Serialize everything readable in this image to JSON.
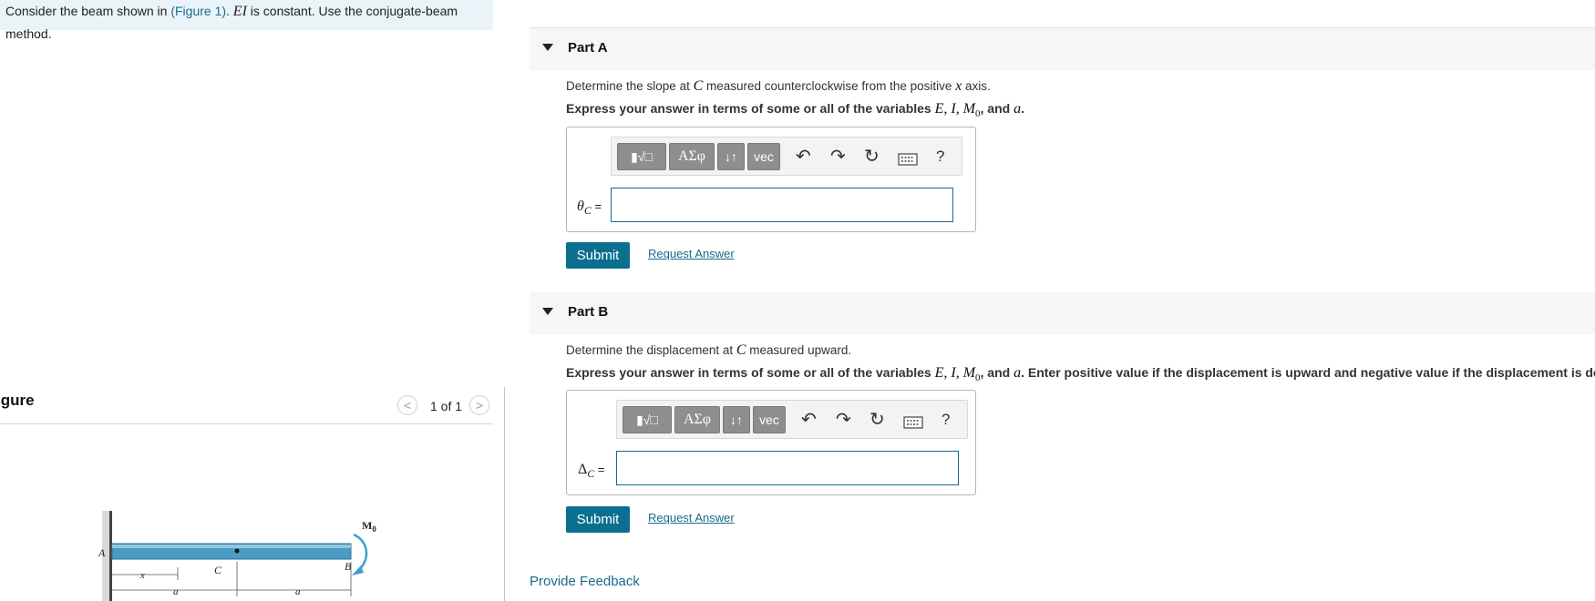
{
  "intro": {
    "text_before": "Consider the beam shown in ",
    "figure_link": "(Figure 1)",
    "text_middle": ". ",
    "ei": "EI",
    "text_after": " is constant. Use the conjugate-beam method."
  },
  "figure_panel": {
    "title": "igure",
    "pager": "1 of 1",
    "prev_icon": "chevron-left-icon",
    "next_icon": "chevron-right-icon",
    "labels": {
      "A": "A",
      "B": "B",
      "C": "C",
      "M": "M",
      "M_sub": "0",
      "x": "x",
      "a1": "a",
      "a2": "a"
    }
  },
  "toolbar": {
    "templates_icon": "templates-icon",
    "greek": "ΑΣφ",
    "arrows": "↓↑",
    "vec": "vec",
    "undo": "↶",
    "redo": "↷",
    "reset": "↻",
    "keyboard_icon": "keyboard-icon",
    "help": "?"
  },
  "partA": {
    "title": "Part A",
    "question_pre": "Determine the slope at ",
    "question_var": "C",
    "question_post": " measured counterclockwise from the positive ",
    "question_axis": "x",
    "question_end": " axis.",
    "express_pre": "Express your answer in terms of some or all of the variables ",
    "express_vars": "E, I, M",
    "express_sub": "0",
    "express_and": ", and ",
    "express_a": "a",
    "express_end": ".",
    "answer_label": "θ",
    "answer_sub": "C",
    "answer_eq": " =",
    "submit": "Submit",
    "request": "Request Answer"
  },
  "partB": {
    "title": "Part B",
    "question_pre": "Determine the displacement at ",
    "question_var": "C",
    "question_post": " measured upward.",
    "express_pre": "Express your answer in terms of some or all of the variables ",
    "express_vars": "E, I, M",
    "express_sub": "0",
    "express_and": ", and ",
    "express_a": "a",
    "express_end": ". Enter positive value if the displacement is upward and negative value if the displacement is downward.",
    "answer_label": "Δ",
    "answer_sub": "C",
    "answer_eq": " =",
    "submit": "Submit",
    "request": "Request Answer"
  },
  "feedback": "Provide Feedback",
  "colors": {
    "accent": "#0b6f8f",
    "link": "#1a6a8e",
    "beam": "#4a9cc4"
  }
}
